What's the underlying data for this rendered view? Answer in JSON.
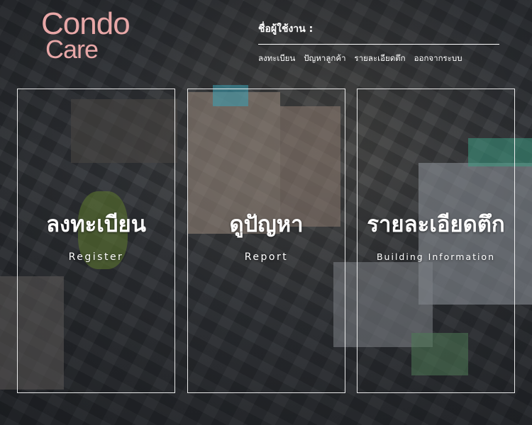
{
  "logo": {
    "line1": "Condo",
    "line2": "Care"
  },
  "header": {
    "username_label": "ชื่อผู้ใช้งาน :",
    "nav": [
      {
        "label": "ลงทะเบียน"
      },
      {
        "label": "ปัญหาลูกค้า"
      },
      {
        "label": "รายละเอียดตึก"
      },
      {
        "label": "ออกจากระบบ"
      }
    ]
  },
  "cards": [
    {
      "title": "ลงทะเบียน",
      "subtitle": "Register"
    },
    {
      "title": "ดูปัญหา",
      "subtitle": "Report"
    },
    {
      "title": "รายละเอียดตึก",
      "subtitle": "Building Information"
    }
  ],
  "colors": {
    "logo": "#e8a7a7",
    "text": "#ffffff",
    "border": "#ffffff"
  }
}
